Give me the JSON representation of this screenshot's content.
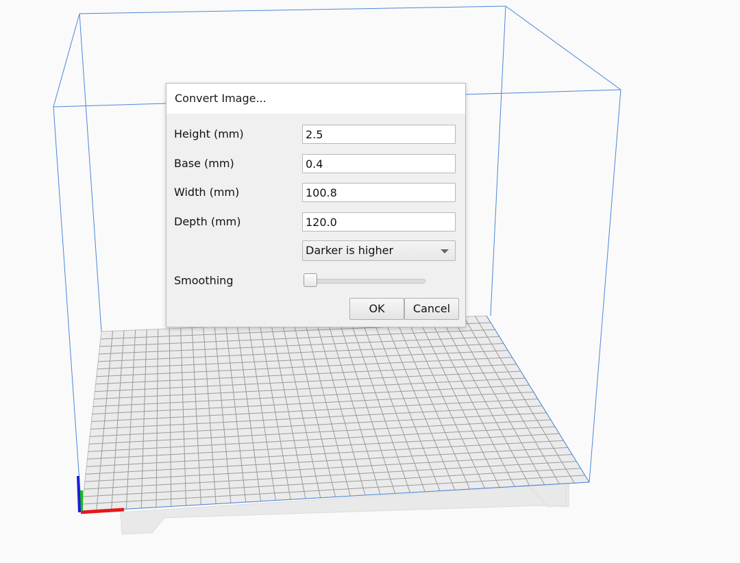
{
  "dialog": {
    "title": "Convert Image...",
    "fields": {
      "height": {
        "label": "Height (mm)",
        "value": "2.5"
      },
      "base": {
        "label": "Base (mm)",
        "value": "0.4"
      },
      "width": {
        "label": "Width (mm)",
        "value": "100.8"
      },
      "depth": {
        "label": "Depth (mm)",
        "value": "120.0"
      }
    },
    "mode_select": {
      "selected": "Darker is higher"
    },
    "smoothing": {
      "label": "Smoothing",
      "level": 0
    },
    "ok_label": "OK",
    "cancel_label": "Cancel"
  },
  "scene": {
    "volume_color": "#4a86d8",
    "axis_x_color": "#e8161b",
    "axis_y_color": "#1c1cd9",
    "axis_z_color": "#19b81c"
  }
}
